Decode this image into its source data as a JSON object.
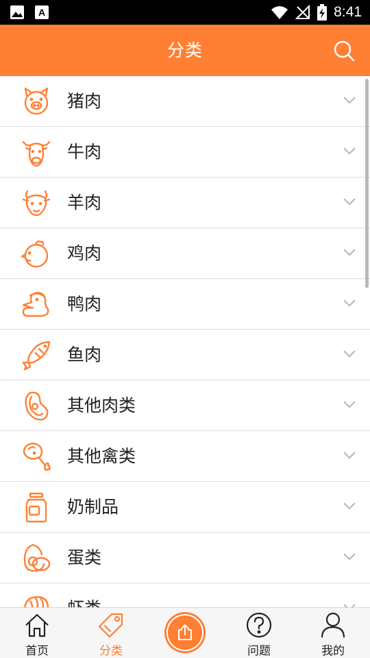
{
  "status_bar": {
    "time": "8:41",
    "left_icons": [
      "image-icon",
      "text-a-icon"
    ],
    "right_icons": [
      "wifi-icon",
      "no-signal-icon",
      "battery-charging-icon"
    ]
  },
  "header": {
    "title": "分类",
    "search_icon": "search-icon"
  },
  "categories": [
    {
      "label": "猪肉",
      "icon": "pig-icon"
    },
    {
      "label": "牛肉",
      "icon": "cow-icon"
    },
    {
      "label": "羊肉",
      "icon": "sheep-icon"
    },
    {
      "label": "鸡肉",
      "icon": "chicken-icon"
    },
    {
      "label": "鸭肉",
      "icon": "duck-icon"
    },
    {
      "label": "鱼肉",
      "icon": "fish-icon"
    },
    {
      "label": "其他肉类",
      "icon": "steak-icon"
    },
    {
      "label": "其他禽类",
      "icon": "drumstick-icon"
    },
    {
      "label": "奶制品",
      "icon": "milk-jar-icon"
    },
    {
      "label": "蛋类",
      "icon": "egg-icon"
    },
    {
      "label": "虾类",
      "icon": "shrimp-icon"
    }
  ],
  "bottom_nav": {
    "items": [
      {
        "label": "首页",
        "icon": "home-icon",
        "active": false
      },
      {
        "label": "分类",
        "icon": "tag-icon",
        "active": true
      },
      {
        "label": "问题",
        "icon": "question-icon",
        "active": false
      },
      {
        "label": "我的",
        "icon": "person-icon",
        "active": false
      }
    ],
    "publish_icon": "share-upload-icon"
  },
  "colors": {
    "accent": "#ff7f33",
    "divider": "#dedede",
    "text": "#222222"
  }
}
